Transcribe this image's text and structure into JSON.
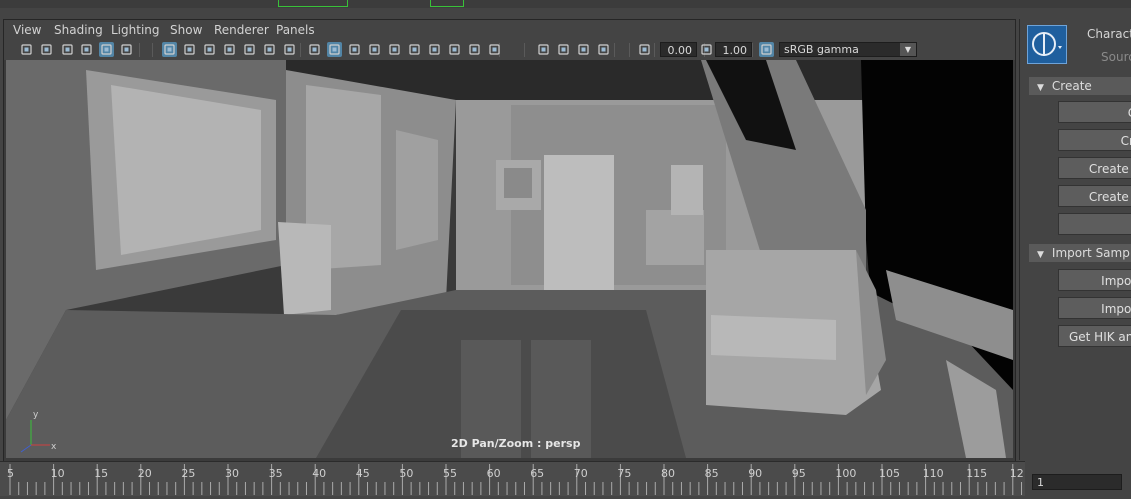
{
  "viewport": {
    "menu": [
      "View",
      "Shading",
      "Lighting",
      "Show",
      "Renderer",
      "Panels"
    ],
    "exposure_value": "0.00",
    "gamma_value": "1.00",
    "color_space": "sRGB gamma",
    "hud_text": "2D Pan/Zoom : persp",
    "axis_labels": {
      "y": "y",
      "x": "x"
    }
  },
  "toolbar_icons": [
    "select-camera-icon",
    "camera-attributes-icon",
    "bookmark-icon",
    "image-plane-icon",
    "2d-pan-zoom-icon",
    "grease-pencil-icon",
    "grid-icon",
    "film-gate-icon",
    "resolution-gate-icon",
    "gate-mask-icon",
    "field-chart-icon",
    "safe-action-icon",
    "safe-title-icon",
    "wireframe-icon",
    "smooth-shade-icon",
    "default-material-icon",
    "textured-icon",
    "use-all-lights-icon",
    "shadows-icon",
    "screen-space-ao-icon",
    "motion-blur-icon",
    "multisample-aa-icon",
    "depth-of-field-icon",
    "isolate-select-icon",
    "xray-icon",
    "xray-joints-icon",
    "xray-components-icon",
    "exposure-icon",
    "gamma-icon",
    "color-management-icon"
  ],
  "right_panel": {
    "title": "Characte",
    "source_label": "Sourc",
    "sections": [
      {
        "label": "Create",
        "buttons": [
          "Cr",
          "Cre",
          "Create C",
          "Create C",
          "C"
        ]
      },
      {
        "label": "Import Sample",
        "buttons": [
          "Import",
          "Import",
          "Get HIK and"
        ]
      }
    ]
  },
  "timeline": {
    "ticks": [
      "5",
      "10",
      "15",
      "20",
      "25",
      "30",
      "35",
      "40",
      "45",
      "50",
      "55",
      "60",
      "65",
      "70",
      "75",
      "80",
      "85",
      "90",
      "95",
      "100",
      "105",
      "110",
      "115",
      "12"
    ],
    "current_frame": "1"
  }
}
